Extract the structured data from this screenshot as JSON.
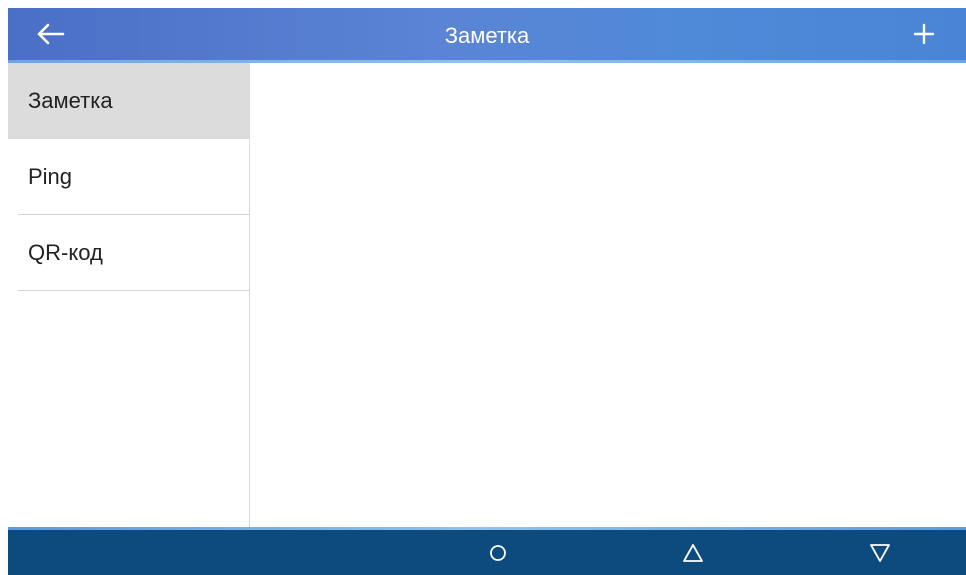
{
  "header": {
    "title": "Заметка",
    "back_icon": "arrow-left-icon",
    "add_icon": "plus-icon"
  },
  "sidebar": {
    "items": [
      {
        "label": "Заметка",
        "active": true
      },
      {
        "label": "Ping",
        "active": false
      },
      {
        "label": "QR-код",
        "active": false
      }
    ]
  },
  "navbar": {
    "home_icon": "circle-icon",
    "back_icon": "triangle-up-icon",
    "recents_icon": "triangle-down-icon"
  },
  "colors": {
    "header_bg": "#5b84d4",
    "navbar_bg": "#0d4a7e",
    "active_item_bg": "#dcdcdc"
  }
}
